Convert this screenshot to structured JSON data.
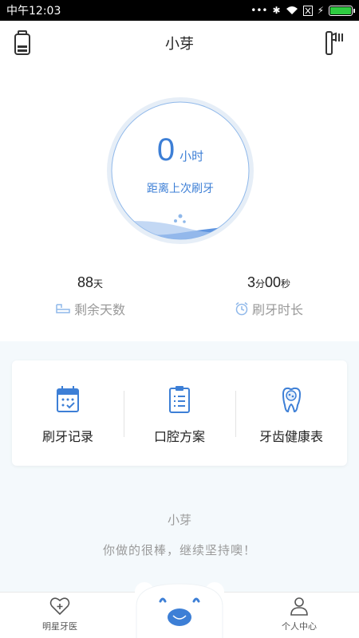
{
  "status_bar": {
    "carrier_time": "中午12:03",
    "battery_level": 1.0,
    "icons": [
      "more-icon",
      "bluetooth-icon",
      "wifi-icon",
      "sim-off-icon",
      "charging-icon"
    ]
  },
  "header": {
    "title": "小芽",
    "left_icon": "battery-icon",
    "right_icon": "toothbrush-icon"
  },
  "dial": {
    "value": "0",
    "unit": "小时",
    "caption": "距离上次刷牙"
  },
  "stats": {
    "remaining": {
      "value": "88",
      "unit": "天",
      "label": "剩余天数"
    },
    "duration": {
      "min": "3",
      "min_unit": "分",
      "sec": "00",
      "sec_unit": "秒",
      "label": "刷牙时长"
    }
  },
  "features": [
    {
      "label": "刷牙记录",
      "icon": "calendar-icon"
    },
    {
      "label": "口腔方案",
      "icon": "clipboard-icon"
    },
    {
      "label": "牙齿健康表",
      "icon": "tooth-icon"
    }
  ],
  "message": {
    "name": "小芽",
    "text": "你做的很棒，继续坚持噢！"
  },
  "tabs": {
    "left": "明星牙医",
    "right": "个人中心"
  },
  "colors": {
    "accent": "#3d7fd6",
    "accent_light": "#8fb8ea",
    "muted_text": "#999999"
  }
}
